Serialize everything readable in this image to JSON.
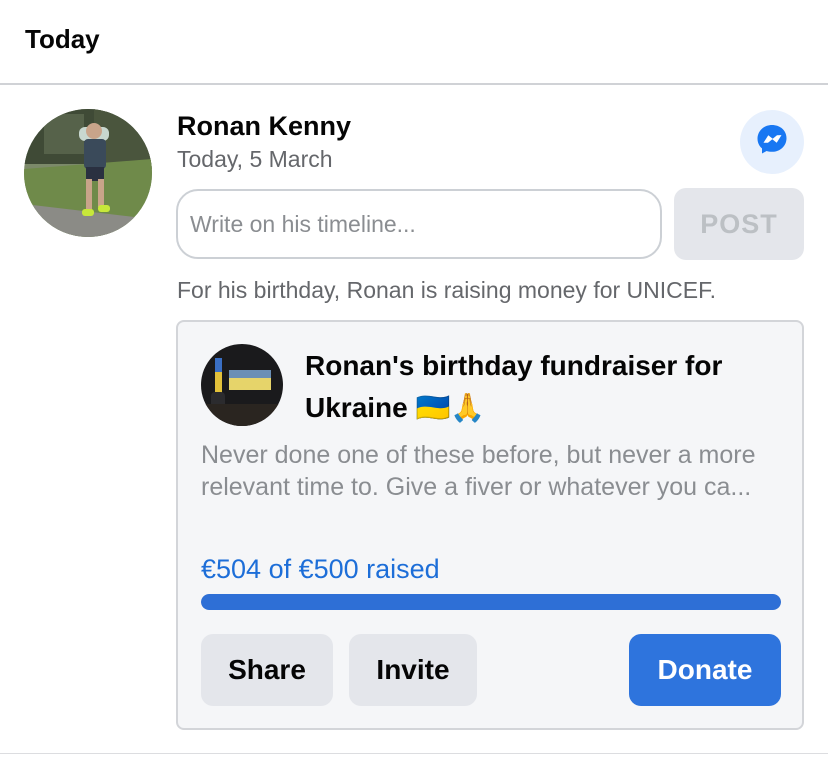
{
  "section": {
    "title": "Today"
  },
  "person": {
    "name": "Ronan Kenny",
    "date": "Today, 5 March"
  },
  "timeline": {
    "placeholder": "Write on his timeline...",
    "post_label": "POST"
  },
  "fundraiser": {
    "caption": "For his birthday, Ronan is raising money for UNICEF.",
    "title": "Ronan's birthday fundraiser for Ukraine 🇺🇦🙏",
    "description": "Never done one of these before, but never a more relevant time to. Give a fiver or whatever you ca...",
    "raised_text": "€504 of €500 raised",
    "progress_fraction": 1.0,
    "share_label": "Share",
    "invite_label": "Invite",
    "donate_label": "Donate"
  },
  "colors": {
    "accent": "#2e74dd",
    "link": "#1d6ed8",
    "messenger": "#1877f2"
  },
  "icons": {
    "messenger": "messenger-icon"
  }
}
